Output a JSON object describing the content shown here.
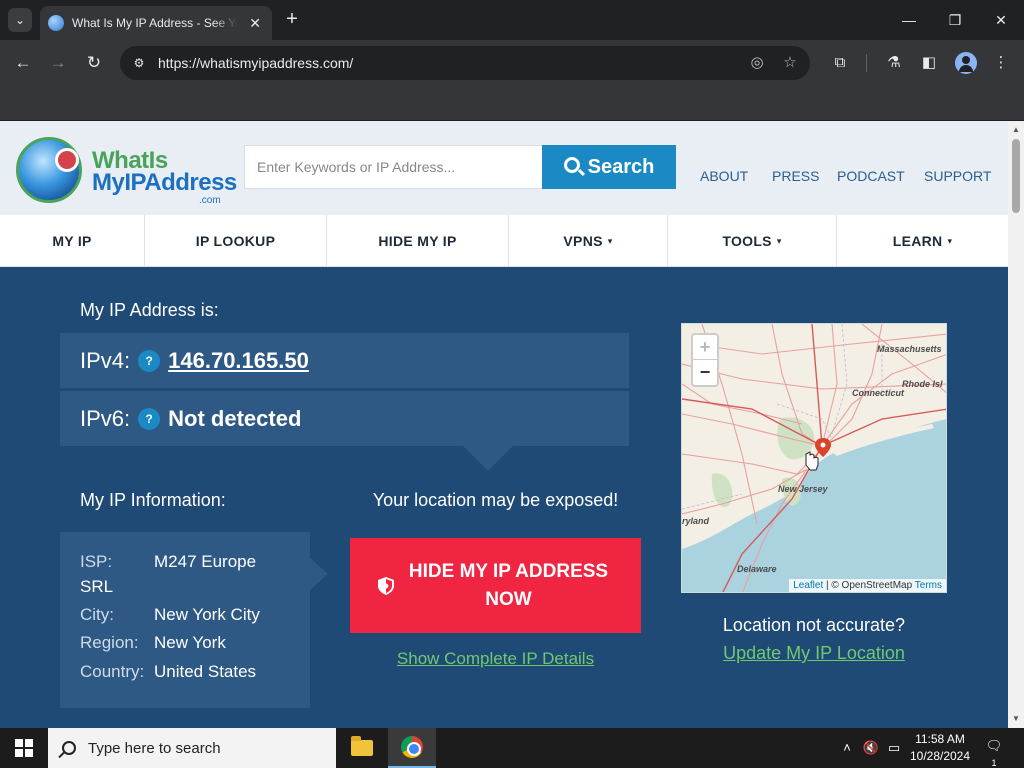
{
  "browser": {
    "tab_title": "What Is My IP Address - See Your Public IP",
    "url": "https://whatismyipaddress.com/",
    "icons": [
      "tab-search-icon",
      "globe-favicon-icon",
      "close-icon",
      "plus-icon",
      "minimize-icon",
      "restore-icon",
      "back-icon",
      "forward-icon",
      "reload-icon",
      "site-settings-icon",
      "eye-slash-icon",
      "star-icon",
      "extensions-icon",
      "labs-flask-icon",
      "side-panel-icon",
      "profile-icon",
      "more-vert-icon"
    ]
  },
  "site": {
    "logo": {
      "line1": "WhatIs",
      "line2": "MyIPAddress",
      "suffix": ".com"
    },
    "search": {
      "placeholder": "Enter Keywords or IP Address...",
      "button": "Search"
    },
    "top_links": [
      "ABOUT",
      "PRESS",
      "PODCAST",
      "SUPPORT"
    ],
    "nav": [
      {
        "label": "MY IP",
        "has_menu": false
      },
      {
        "label": "IP LOOKUP",
        "has_menu": false
      },
      {
        "label": "HIDE MY IP",
        "has_menu": false
      },
      {
        "label": "VPNS",
        "has_menu": true
      },
      {
        "label": "TOOLS",
        "has_menu": true
      },
      {
        "label": "LEARN",
        "has_menu": true
      }
    ],
    "caret": "▾"
  },
  "hero": {
    "title": "My IP Address is:",
    "ipv4_label": "IPv4:",
    "ipv4_value": "146.70.165.50",
    "ipv6_label": "IPv6:",
    "ipv6_value": "Not detected",
    "help": "?",
    "info_title": "My IP Information:",
    "info": {
      "isp_label": "ISP:",
      "isp_line1": "M247 Europe",
      "isp_line2": "SRL",
      "city_label": "City:",
      "city": "New York City",
      "region_label": "Region:",
      "region": "New York",
      "country_label": "Country:",
      "country": "United States"
    },
    "exposed": "Your location may be exposed!",
    "hide_button": "HIDE MY IP ADDRESS NOW",
    "details_link": "Show Complete IP Details",
    "accuracy_question": "Location not accurate?",
    "update_link": "Update My IP Location"
  },
  "map": {
    "zoom_in": "+",
    "zoom_out": "−",
    "labels": [
      "Massachusetts",
      "Rhode Isl",
      "Connecticut",
      "New Jersey",
      "ryland",
      "Delaware"
    ],
    "attribution": {
      "leaflet": "Leaflet",
      "sep": "|",
      "osm": "© OpenStreetMap",
      "terms": "Terms"
    }
  },
  "taskbar": {
    "search_placeholder": "Type here to search",
    "time": "11:58 AM",
    "date": "10/28/2024",
    "notification_count": "1"
  },
  "colors": {
    "hero_bg": "#1f4a76",
    "panel_bg": "#2d5984",
    "accent_blue": "#1b8ac4",
    "cta_red": "#ef2541",
    "link_green": "#6fc96f"
  }
}
